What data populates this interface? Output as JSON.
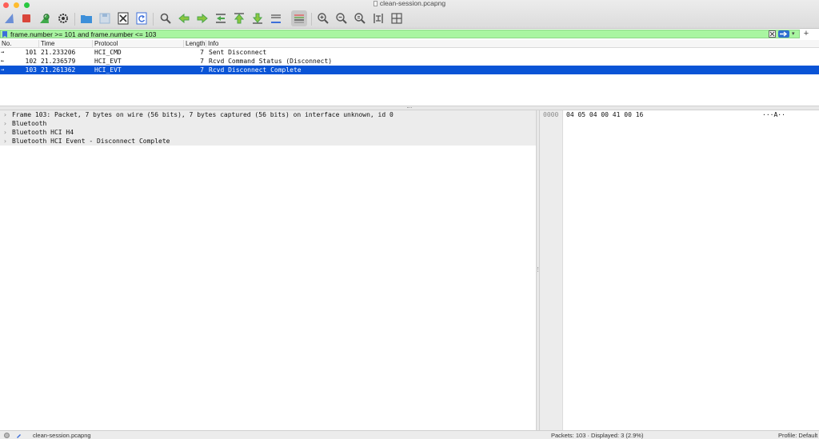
{
  "window": {
    "title": "clean-session.pcapng"
  },
  "toolbar": {
    "buttons": [
      {
        "name": "shark-fin-start-icon",
        "color": "#6b8fd6"
      },
      {
        "name": "stop-capture-icon",
        "color": "#d9453a"
      },
      {
        "name": "restart-capture-icon",
        "color": "#3faa4a"
      },
      {
        "name": "capture-options-gear-icon",
        "color": "#333333"
      },
      {
        "name": "open-file-icon",
        "color": "#3d8fd9"
      },
      {
        "name": "save-file-icon",
        "color": "#9ab7d6"
      },
      {
        "name": "close-file-icon",
        "color": "#333333"
      },
      {
        "name": "reload-file-icon",
        "color": "#3d6fd9"
      },
      {
        "name": "find-packet-icon",
        "color": "#555555"
      },
      {
        "name": "go-back-icon",
        "color": "#4aa64a"
      },
      {
        "name": "go-forward-icon",
        "color": "#4aa64a"
      },
      {
        "name": "go-to-packet-icon",
        "color": "#4aa64a"
      },
      {
        "name": "go-first-packet-icon",
        "color": "#4aa64a"
      },
      {
        "name": "go-last-packet-icon",
        "color": "#4aa64a"
      },
      {
        "name": "auto-scroll-icon",
        "color": "#555555"
      },
      {
        "name": "colorize-icon",
        "color": "#555555"
      },
      {
        "name": "zoom-in-icon",
        "color": "#555555"
      },
      {
        "name": "zoom-out-icon",
        "color": "#555555"
      },
      {
        "name": "normal-size-icon",
        "color": "#555555"
      },
      {
        "name": "resize-columns-icon",
        "color": "#555555"
      },
      {
        "name": "layout-icon",
        "color": "#555555"
      }
    ]
  },
  "filter": {
    "text": "frame.number >= 101 and frame.number <= 103",
    "background": "#a9f5a1"
  },
  "packet_list": {
    "columns": [
      "No.",
      "Time",
      "Protocol",
      "Length",
      "Info"
    ],
    "rows": [
      {
        "arrow": "→",
        "no": "101",
        "time": "21.233206",
        "protocol": "HCI_CMD",
        "length": "7",
        "info": "Sent Disconnect",
        "selected": false
      },
      {
        "arrow": "←",
        "no": "102",
        "time": "21.236579",
        "protocol": "HCI_EVT",
        "length": "7",
        "info": "Rcvd Command Status (Disconnect)",
        "selected": false
      },
      {
        "arrow": "→",
        "no": "103",
        "time": "21.261362",
        "protocol": "HCI_EVT",
        "length": "7",
        "info": "Rcvd Disconnect Complete",
        "selected": true
      }
    ],
    "selected_color": "#0a54d6"
  },
  "details": {
    "items": [
      {
        "label": "Frame 103: Packet, 7 bytes on wire (56 bits), 7 bytes captured (56 bits) on interface unknown, id 0"
      },
      {
        "label": "Bluetooth"
      },
      {
        "label": "Bluetooth HCI H4"
      },
      {
        "label": "Bluetooth HCI Event - Disconnect Complete"
      }
    ]
  },
  "bytes": {
    "rows": [
      {
        "offset": "0000",
        "hex": "04 05 04 00 41 00 16",
        "ascii": "···A··"
      }
    ]
  },
  "status": {
    "file": "clean-session.pcapng",
    "packets": "Packets: 103 · Displayed: 3 (2.9%)",
    "profile": "Profile: Default"
  }
}
